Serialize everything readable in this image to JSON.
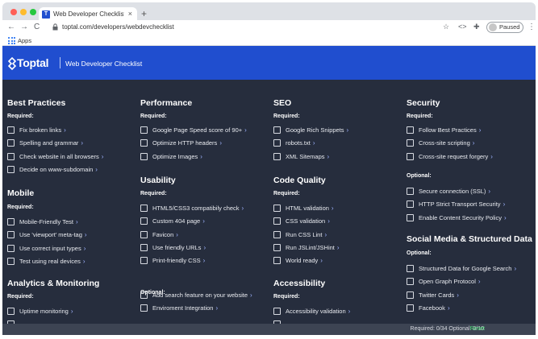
{
  "browser": {
    "tab_title": "Web Developer Checklist: Web",
    "tab_favicon": "T",
    "tab_close": "×",
    "new_tab": "+",
    "url": "toptal.com/developers/webdevchecklist",
    "profile_label": "Paused",
    "bookmarks": {
      "apps_label": "Apps"
    },
    "icons": {
      "back": "←",
      "forward": "→",
      "reload": "C",
      "star": "☆",
      "extension": "✦",
      "puzzle": "✚",
      "menu": "⋮",
      "code": "<>"
    }
  },
  "page": {
    "header": {
      "logo_text": "Toptal",
      "title": "Web Developer Checklist"
    },
    "columns": [
      [
        {
          "title": "Best Practices",
          "subtitle": "Required:",
          "items": [
            "Fix broken links",
            "Spelling and grammar",
            "Check website in all browsers",
            "Decide on www-subdomain"
          ]
        },
        {
          "title": "Mobile",
          "subtitle": "Required:",
          "items": [
            "Mobile-Friendly Test",
            "Use 'viewport' meta-tag",
            "Use correct input types",
            "Test using real devices"
          ]
        },
        {
          "title": "Analytics & Monitoring",
          "subtitle": "Required:",
          "items": [
            "Uptime monitoring",
            ""
          ]
        }
      ],
      [
        {
          "title": "Performance",
          "subtitle": "Required:",
          "items": [
            "Google Page Speed score of 90+",
            "Optimize HTTP headers",
            "Optimize Images"
          ]
        },
        {
          "title": "Usability",
          "subtitle": "Required:",
          "items": [
            "HTML5/CSS3 compatibily check",
            "Custom 404 page",
            "Favicon",
            "Use friendly URLs",
            "Print-friendly CSS"
          ]
        },
        {
          "title": "",
          "subtitle": "Optional:",
          "items": [
            "Add search feature on your website",
            "Enviroment Integration"
          ]
        }
      ],
      [
        {
          "title": "SEO",
          "subtitle": "Required:",
          "items": [
            "Google Rich Snippets",
            "robots.txt",
            "XML Sitemaps"
          ]
        },
        {
          "title": "Code Quality",
          "subtitle": "Required:",
          "items": [
            "HTML validation",
            "CSS validation",
            "Run CSS Lint",
            "Run JSLint/JSHint",
            "World ready"
          ]
        },
        {
          "title": "Accessibility",
          "subtitle": "Required:",
          "items": [
            "Accessibility validation",
            ""
          ]
        }
      ],
      [
        {
          "title": "Security",
          "subtitle": "Required:",
          "items": [
            "Follow Best Practices",
            "Cross-site scripting",
            "Cross-site request forgery"
          ]
        },
        {
          "title": "",
          "subtitle": "Optional:",
          "items": [
            "Secure connection (SSL)",
            "HTTP Strict Transport Security",
            "Enable Content Security Policy"
          ]
        },
        {
          "title": "Social Media & Structured Data",
          "subtitle": "Optional:",
          "items": [
            "Structured Data for Google Search",
            "Open Graph Protocol",
            "Twitter Cards",
            "Facebook"
          ]
        }
      ]
    ],
    "chevron": "›",
    "footer": {
      "progress_text": "Required: 0/34   Optional: 0/10",
      "reset_label": "Reset"
    },
    "colors": {
      "header_bg": "#204ecf",
      "content_bg": "#262d3d",
      "reset": "#4ee07a"
    }
  }
}
